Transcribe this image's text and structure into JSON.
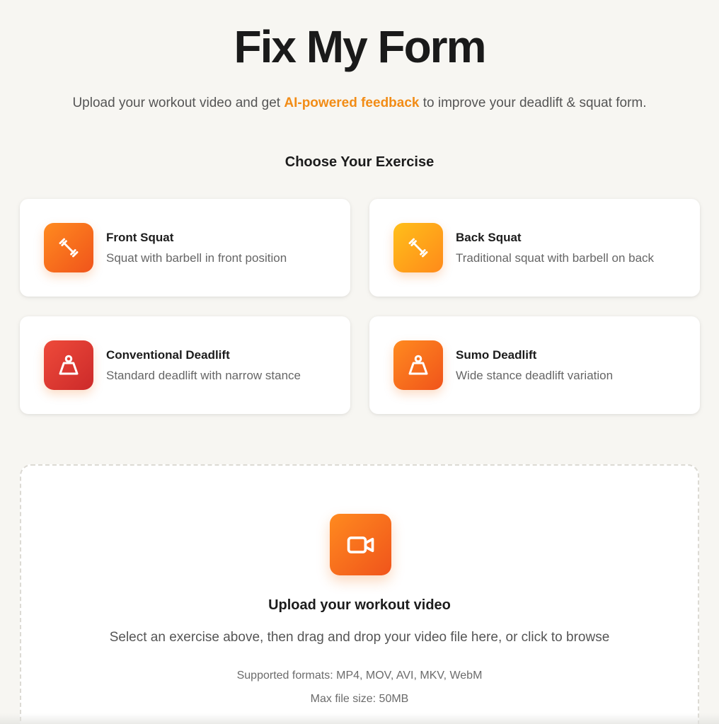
{
  "header": {
    "title": "Fix My Form",
    "subtitle_before": "Upload your workout video and get ",
    "subtitle_accent": "AI-powered feedback",
    "subtitle_after": " to improve your deadlift & squat form."
  },
  "exercise_section": {
    "heading": "Choose Your Exercise",
    "exercises": [
      {
        "title": "Front Squat",
        "description": "Squat with barbell in front position",
        "icon": "dumbbell-icon",
        "color": "#f7731c"
      },
      {
        "title": "Back Squat",
        "description": "Traditional squat with barbell on back",
        "icon": "dumbbell-icon",
        "color": "#ffa61a"
      },
      {
        "title": "Conventional Deadlift",
        "description": "Standard deadlift with narrow stance",
        "icon": "kettlebell-icon",
        "color": "#dd3a32"
      },
      {
        "title": "Sumo Deadlift",
        "description": "Wide stance deadlift variation",
        "icon": "kettlebell-icon",
        "color": "#f7731c"
      }
    ]
  },
  "upload": {
    "icon": "video-camera-icon",
    "title": "Upload your workout video",
    "description": "Select an exercise above, then drag and drop your video file here, or click to browse",
    "formats": "Supported formats: MP4, MOV, AVI, MKV, WebM",
    "max_size": "Max file size: 50MB"
  },
  "colors": {
    "accent": "#f28c16",
    "background": "#f7f6f2"
  }
}
